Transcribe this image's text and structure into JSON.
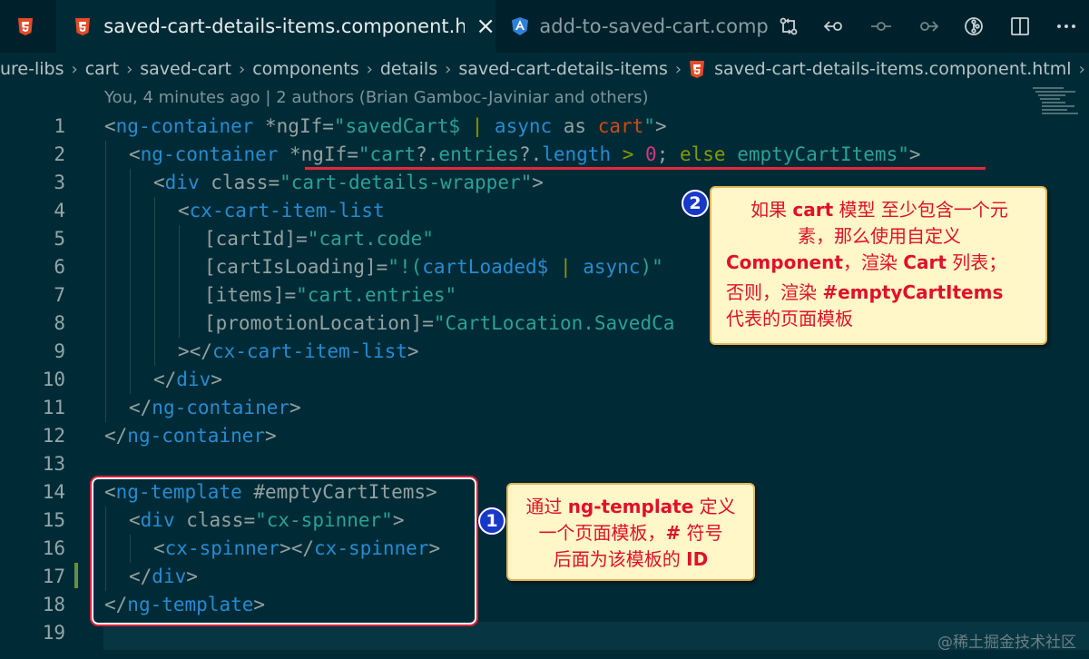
{
  "tabs": {
    "active": {
      "title": "saved-cart-details-items.component.html",
      "close": "×"
    },
    "inactive": {
      "title": "add-to-saved-cart.compor"
    }
  },
  "icons": {
    "html": "html5-icon",
    "angular": "angular-icon",
    "actions": [
      "source-control-compare-icon",
      "go-back-icon",
      "git-commit-icon",
      "go-forward-icon",
      "git-lens-icon",
      "split-editor-icon",
      "more-actions-icon"
    ]
  },
  "breadcrumb": [
    "ure-libs",
    "cart",
    "saved-cart",
    "components",
    "details",
    "saved-cart-details-items",
    "saved-cart-details-items.component.html"
  ],
  "blame": "You, 4 minutes ago | 2 authors (Brian Gamboc-Javiniar and others)",
  "lines": {
    "n": [
      "1",
      "2",
      "3",
      "4",
      "5",
      "6",
      "7",
      "8",
      "9",
      "10",
      "11",
      "12",
      "13",
      "14",
      "15",
      "16",
      "17",
      "18",
      "19"
    ],
    "l1": [
      "<",
      "ng-container",
      " *ngIf=",
      "\"",
      "savedCart$",
      " | ",
      "async",
      " as ",
      "cart",
      "\"",
      ">"
    ],
    "l2": [
      "<",
      "ng-container",
      " *ngIf=",
      "\"",
      "cart",
      "?.",
      "entries",
      "?.",
      "length",
      " > ",
      "0",
      "; ",
      "else",
      " ",
      "emptyCartItems",
      "\"",
      ">"
    ],
    "l3": [
      "<",
      "div",
      " class=",
      "\"cart-details-wrapper\"",
      ">"
    ],
    "l4": [
      "<",
      "cx-cart-item-list"
    ],
    "l5": [
      "[cartId]=",
      "\"cart.code\""
    ],
    "l6": [
      "[cartIsLoading]=",
      "\"!(",
      "cartLoaded$",
      " | ",
      "async",
      ")\""
    ],
    "l7": [
      "[items]=",
      "\"cart.entries\""
    ],
    "l8": [
      "[promotionLocation]=",
      "\"CartLocation.SavedCa"
    ],
    "l9": [
      "></",
      "cx-cart-item-list",
      ">"
    ],
    "l10": [
      "</",
      "div",
      ">"
    ],
    "l11": [
      "</",
      "ng-container",
      ">"
    ],
    "l12": [
      "</",
      "ng-container",
      ">"
    ],
    "l14": [
      "<",
      "ng-template",
      " #emptyCartItems",
      ">"
    ],
    "l15": [
      "<",
      "div",
      " class=",
      "\"cx-spinner\"",
      ">"
    ],
    "l16": [
      "<",
      "cx-spinner",
      "></",
      "cx-spinner",
      ">"
    ],
    "l17": [
      "</",
      "div",
      ">"
    ],
    "l18": [
      "</",
      "ng-template",
      ">"
    ]
  },
  "annotations": {
    "badge1": "1",
    "badge2": "2",
    "note1": {
      "a": "通过 ",
      "b": "ng-template",
      "c": " 定义",
      "d": "一个页面模板，",
      "e": "#",
      "f": " 符号",
      "g": "后面为该模板的 ",
      "h": "ID"
    },
    "note2": {
      "a": "如果 ",
      "b": "cart",
      "c": " 模型 至少包含一个元",
      "d": "素，那么使用自定义",
      "e": "Component",
      "f": "，渲染 ",
      "g": "Cart",
      "h": " 列表；",
      "i": "否则，渲染 ",
      "j": "#emptyCartItems",
      "k": "代表的页面模板"
    }
  },
  "watermark": "@稀土掘金技术社区",
  "colors": {
    "background": "#002b36",
    "tag": "#268bd2",
    "string": "#2aa198",
    "keyword": "#859900",
    "variable": "#cb4b16",
    "number": "#d33682",
    "annotation_red": "#e0102a",
    "note_bg": "#fff7c7"
  }
}
